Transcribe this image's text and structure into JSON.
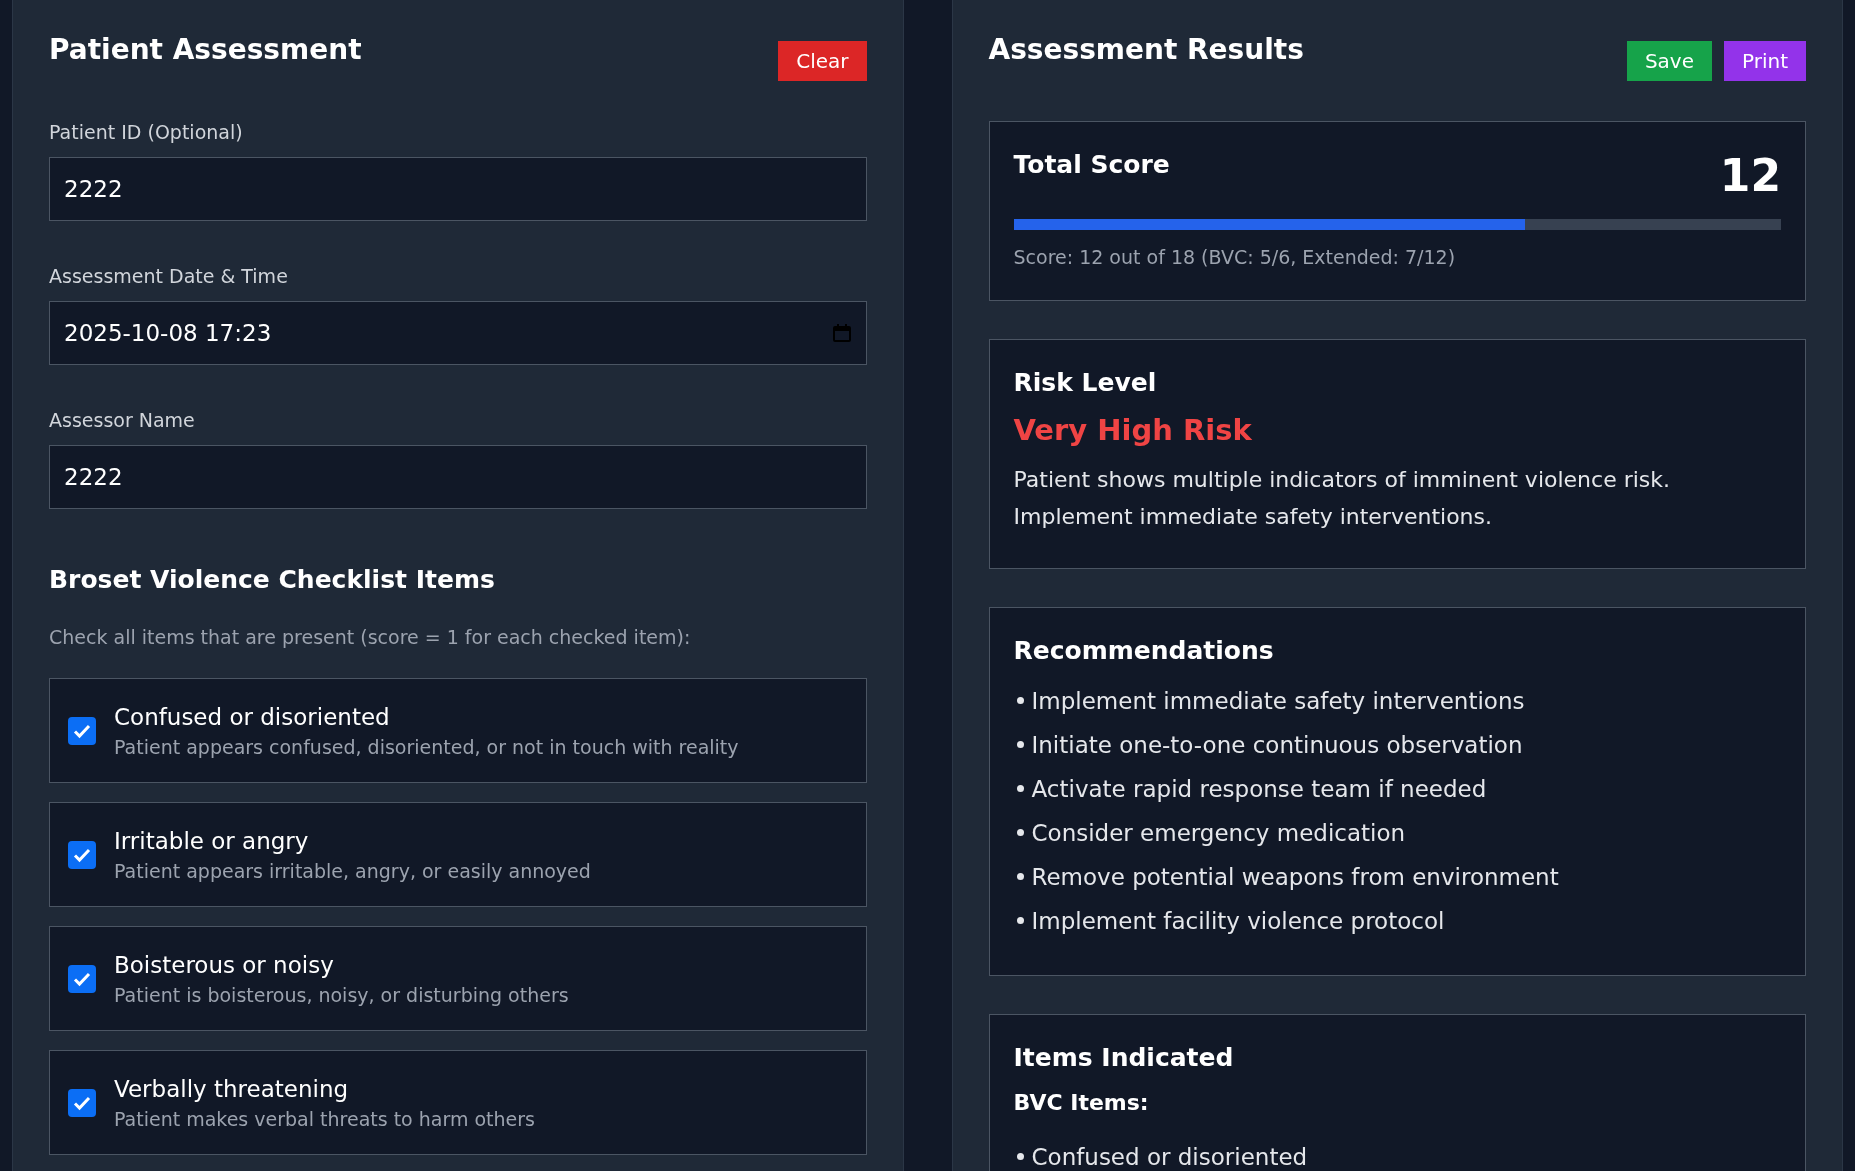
{
  "assessment": {
    "title": "Patient Assessment",
    "clear_button": "Clear",
    "fields": [
      {
        "label": "Patient ID (Optional)",
        "value": "2222",
        "kind": "text"
      },
      {
        "label": "Assessment Date & Time",
        "value": "2025-10-08 17:23",
        "kind": "datetime"
      },
      {
        "label": "Assessor Name",
        "value": "2222",
        "kind": "text"
      }
    ],
    "checklist": {
      "title": "Broset Violence Checklist Items",
      "hint": "Check all items that are present (score = 1 for each checked item):",
      "items": [
        {
          "title": "Confused or disoriented",
          "description": "Patient appears confused, disoriented, or not in touch with reality",
          "checked": true
        },
        {
          "title": "Irritable or angry",
          "description": "Patient appears irritable, angry, or easily annoyed",
          "checked": true
        },
        {
          "title": "Boisterous or noisy",
          "description": "Patient is boisterous, noisy, or disturbing others",
          "checked": true
        },
        {
          "title": "Verbally threatening",
          "description": "Patient makes verbal threats to harm others",
          "checked": true
        }
      ]
    }
  },
  "results": {
    "title": "Assessment Results",
    "buttons": [
      {
        "label": "Save",
        "kind": "save"
      },
      {
        "label": "Print",
        "kind": "print"
      }
    ],
    "total": {
      "title": "Total Score",
      "score": "12",
      "level": 0.667,
      "summary": "Score: 12 out of 18 (BVC: 5/6, Extended: 7/12)"
    },
    "risk": {
      "title": "Risk Level",
      "level_text": "Very High Risk",
      "color": "#ef4444",
      "description": "Patient shows multiple indicators of imminent violence risk. Implement immediate safety interventions."
    },
    "recommendations": {
      "title": "Recommendations",
      "items": [
        "Implement immediate safety interventions",
        "Initiate one-to-one continuous observation",
        "Activate rapid response team if needed",
        "Consider emergency medication",
        "Remove potential weapons from environment",
        "Implement facility violence protocol"
      ]
    },
    "indicated": {
      "title": "Items Indicated",
      "subtitle": "BVC Items:",
      "items": [
        "Confused or disoriented"
      ]
    }
  }
}
